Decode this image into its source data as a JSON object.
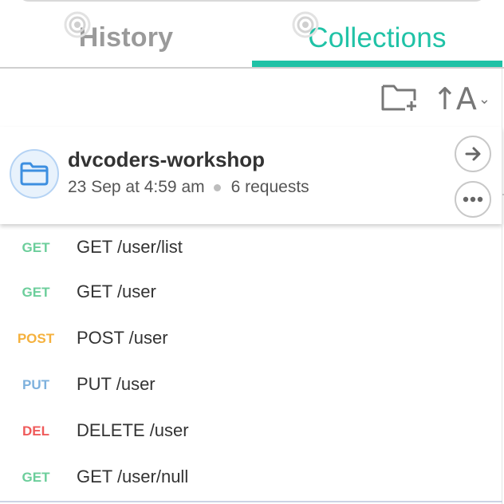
{
  "tabs": {
    "history": "History",
    "collections": "Collections",
    "active_color": "#1fc2a6",
    "inactive_color": "#9a9a9a"
  },
  "toolbar": {
    "new_folder_icon": "folder-plus-icon",
    "sort_label": "↑A",
    "sort_icon": "sort-alpha-icon"
  },
  "collection": {
    "name": "dvcoders-workshop",
    "date": "23 Sep at 4:59 am",
    "count": "6 requests",
    "icon": "folder-icon"
  },
  "requests": [
    {
      "method": "GET",
      "name": "GET /user/list",
      "color": "#6cce9b"
    },
    {
      "method": "GET",
      "name": "GET /user",
      "color": "#6cce9b"
    },
    {
      "method": "POST",
      "name": "POST /user",
      "color": "#f5b13d"
    },
    {
      "method": "PUT",
      "name": "PUT /user",
      "color": "#7eb1dd"
    },
    {
      "method": "DEL",
      "name": "DELETE /user",
      "color": "#ef5a5a"
    },
    {
      "method": "GET",
      "name": "GET /user/null",
      "color": "#6cce9b"
    }
  ]
}
